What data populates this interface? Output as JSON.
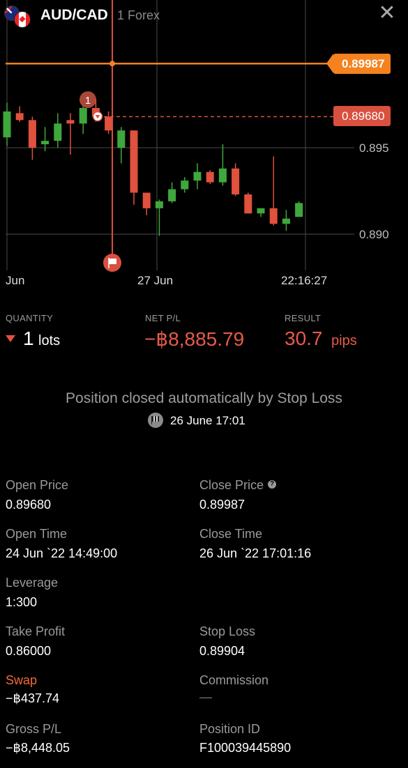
{
  "header": {
    "pair": "AUD/CAD",
    "category": "1 Forex",
    "close_icon": "close-icon",
    "flags": [
      "australia-flag-icon",
      "canada-flag-icon"
    ]
  },
  "chart": {
    "open_price_tag": "0.89680",
    "close_price_tag": "0.89987",
    "y_ticks": [
      "0.895",
      "0.890"
    ],
    "x_ticks": [
      "Jun",
      "27 Jun",
      "22:16:27"
    ],
    "open_marker_label": "1",
    "colors": {
      "up": "#3fa83c",
      "down": "#e0513e",
      "close_line": "#f5821f",
      "open_line": "#d9503f"
    }
  },
  "chart_data": {
    "type": "candlestick",
    "ylim": [
      0.8888,
      0.8998
    ],
    "y_ticks": [
      0.895,
      0.89
    ],
    "x_labels": [
      "Jun",
      "27 Jun",
      "22:16:27"
    ],
    "open_price": 0.8968,
    "close_price": 0.89987,
    "candles": [
      {
        "o": 0.8956,
        "h": 0.8976,
        "l": 0.8951,
        "c": 0.8971
      },
      {
        "o": 0.897,
        "h": 0.8974,
        "l": 0.8965,
        "c": 0.8966
      },
      {
        "o": 0.8966,
        "h": 0.8968,
        "l": 0.8943,
        "c": 0.895
      },
      {
        "o": 0.8952,
        "h": 0.8962,
        "l": 0.8948,
        "c": 0.8954
      },
      {
        "o": 0.8954,
        "h": 0.897,
        "l": 0.895,
        "c": 0.8964
      },
      {
        "o": 0.8966,
        "h": 0.897,
        "l": 0.8946,
        "c": 0.8964
      },
      {
        "o": 0.8964,
        "h": 0.8974,
        "l": 0.8958,
        "c": 0.8973
      },
      {
        "o": 0.8973,
        "h": 0.8978,
        "l": 0.8965,
        "c": 0.8968
      },
      {
        "o": 0.8968,
        "h": 0.8971,
        "l": 0.8958,
        "c": 0.896
      },
      {
        "o": 0.895,
        "h": 0.8962,
        "l": 0.8941,
        "c": 0.896
      },
      {
        "o": 0.896,
        "h": 0.896,
        "l": 0.8917,
        "c": 0.8924
      },
      {
        "o": 0.8924,
        "h": 0.8924,
        "l": 0.8911,
        "c": 0.8915
      },
      {
        "o": 0.8915,
        "h": 0.892,
        "l": 0.8899,
        "c": 0.8919
      },
      {
        "o": 0.8919,
        "h": 0.893,
        "l": 0.8918,
        "c": 0.8926
      },
      {
        "o": 0.8926,
        "h": 0.8933,
        "l": 0.8924,
        "c": 0.8931
      },
      {
        "o": 0.8931,
        "h": 0.8941,
        "l": 0.8926,
        "c": 0.8936
      },
      {
        "o": 0.8936,
        "h": 0.8937,
        "l": 0.8929,
        "c": 0.893
      },
      {
        "o": 0.893,
        "h": 0.8952,
        "l": 0.8928,
        "c": 0.8938
      },
      {
        "o": 0.8938,
        "h": 0.8941,
        "l": 0.8922,
        "c": 0.8923
      },
      {
        "o": 0.8923,
        "h": 0.8924,
        "l": 0.8912,
        "c": 0.8912
      },
      {
        "o": 0.8912,
        "h": 0.8915,
        "l": 0.891,
        "c": 0.8915
      },
      {
        "o": 0.8915,
        "h": 0.8945,
        "l": 0.8905,
        "c": 0.8906
      },
      {
        "o": 0.8906,
        "h": 0.8914,
        "l": 0.8902,
        "c": 0.8909
      },
      {
        "o": 0.891,
        "h": 0.8919,
        "l": 0.891,
        "c": 0.8918
      }
    ]
  },
  "summary": {
    "quantity_label": "QUANTITY",
    "quantity_value": "1",
    "quantity_unit": "lots",
    "netpl_label": "NET P/L",
    "netpl_value": "−฿8,885.79",
    "result_label": "RESULT",
    "result_value": "30.7",
    "result_unit": "pips"
  },
  "closed": {
    "message": "Position closed automatically by Stop Loss",
    "date": "26 June 17:01"
  },
  "details": {
    "open_price_label": "Open Price",
    "open_price": "0.89680",
    "close_price_label": "Close Price",
    "close_price": "0.89987",
    "open_time_label": "Open Time",
    "open_time": "24 Jun `22 14:49:00",
    "close_time_label": "Close Time",
    "close_time": "26 Jun `22 17:01:16",
    "leverage_label": "Leverage",
    "leverage": "1:300",
    "take_profit_label": "Take Profit",
    "take_profit": "0.86000",
    "stop_loss_label": "Stop Loss",
    "stop_loss": "0.89904",
    "swap_label": "Swap",
    "swap": "−฿437.74",
    "commission_label": "Commission",
    "commission": "—",
    "gross_pl_label": "Gross P/L",
    "gross_pl": "−฿8,448.05",
    "position_id_label": "Position ID",
    "position_id": "F100039445890"
  }
}
